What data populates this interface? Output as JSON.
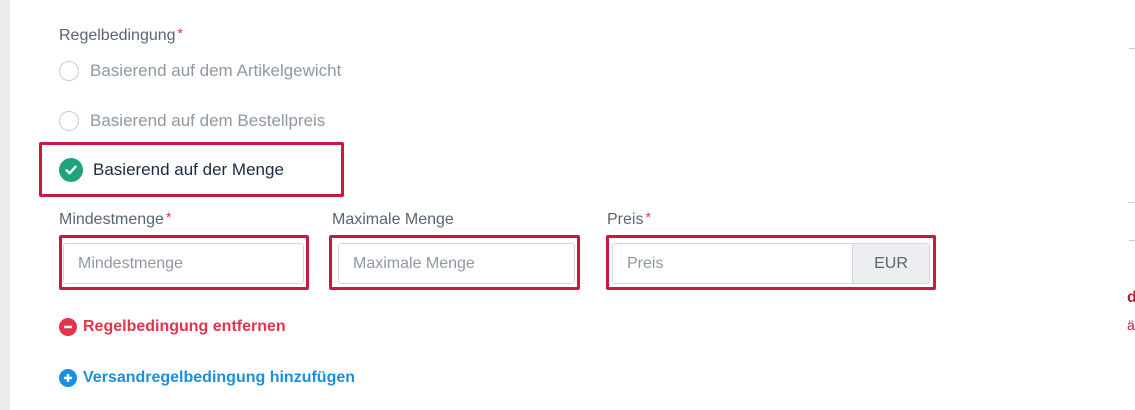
{
  "condition": {
    "label": "Regelbedingung",
    "required_mark": "*",
    "options": [
      {
        "label": "Basierend auf dem Artikelgewicht",
        "selected": false
      },
      {
        "label": "Basierend auf dem Bestellpreis",
        "selected": false
      },
      {
        "label": "Basierend auf der Menge",
        "selected": true
      }
    ]
  },
  "fields": {
    "min_qty": {
      "label": "Mindestmenge",
      "required_mark": "*",
      "placeholder": "Mindestmenge",
      "value": ""
    },
    "max_qty": {
      "label": "Maximale Menge",
      "placeholder": "Maximale Menge",
      "value": ""
    },
    "price": {
      "label": "Preis",
      "required_mark": "*",
      "placeholder": "Preis",
      "value": "",
      "currency": "EUR"
    }
  },
  "actions": {
    "remove_label": "Regelbedingung entfernen",
    "add_label": "Versandregelbedingung hinzufügen"
  },
  "icons": {
    "remove": "minus-circle-icon",
    "add": "plus-circle-icon",
    "checked": "check-circle-icon"
  },
  "colors": {
    "highlight": "#c8193f",
    "required": "#e5334b",
    "remove_link": "#e5334b",
    "add_link": "#1a8fe0",
    "checked_radio": "#1fa37a"
  },
  "background_fragments": {
    "red_letter": "d",
    "red_letter_2": "ä"
  }
}
